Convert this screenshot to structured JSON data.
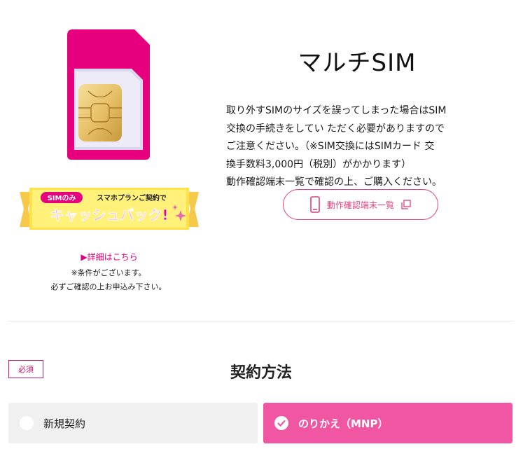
{
  "product": {
    "title": "マルチSIM",
    "description_lines": [
      "取り外すSIMのサイズを誤ってしまった場合はSIM",
      "交換の手続きをしてい ただく必要がありますので",
      "ご注意ください。（※SIM交換にはSIMカード 交",
      "換手数料3,000円（税別）がかかります）",
      "動作確認端末一覧で確認の上、ご購入ください。"
    ],
    "device_list_button": "動作確認端末一覧"
  },
  "promo": {
    "badge": "SIMのみ",
    "headline_small": "スマホプランご契約で",
    "headline_large": "キャッシュバック!",
    "detail_link": "▶詳細はこちら",
    "conditions": [
      "※条件がございます。",
      "必ずご確認の上お申込み下さい。"
    ]
  },
  "contract": {
    "required_badge": "必須",
    "section_title": "契約方法",
    "options": [
      {
        "label": "新規契約",
        "selected": false
      },
      {
        "label": "のりかえ（MNP）",
        "selected": true
      }
    ]
  },
  "colors": {
    "brand_pink": "#e6007e",
    "selected_option": "#f156a3",
    "unselected_option": "#f0f0f0",
    "banner_yellow": "#ffe24a"
  }
}
